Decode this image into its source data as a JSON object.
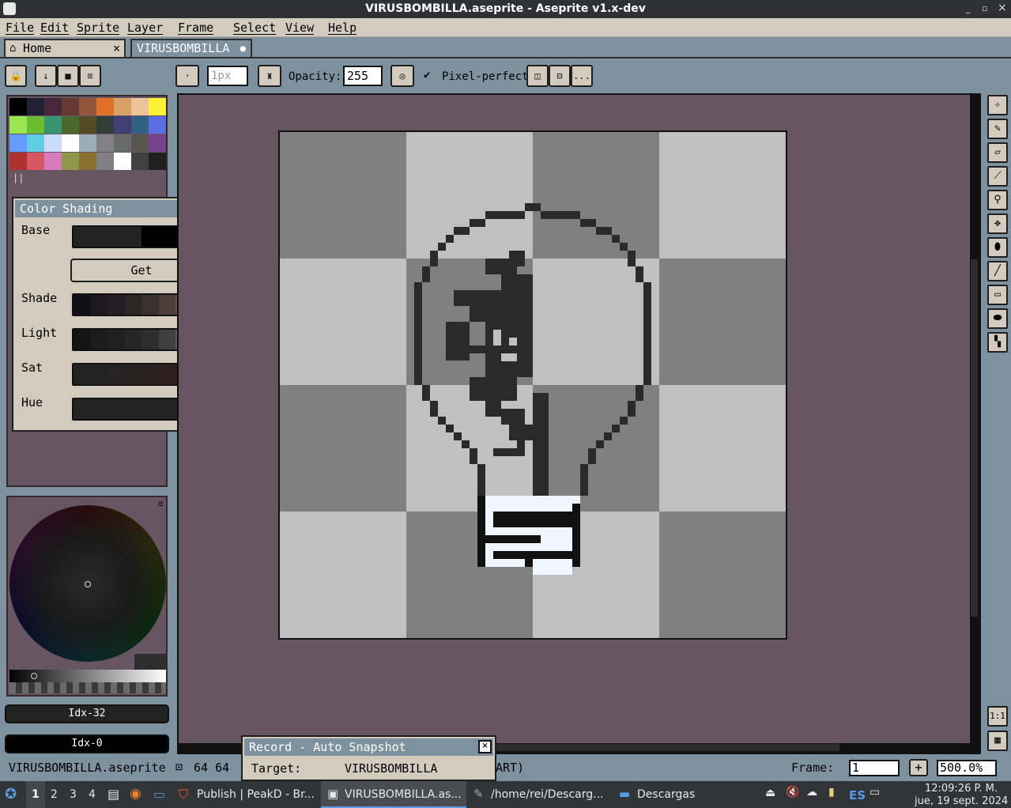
{
  "window": {
    "title": "VIRUSBOMBILLA.aseprite - Aseprite v1.x-dev",
    "min": "_",
    "max": "▫",
    "close": "×"
  },
  "menu": [
    "File",
    "Edit",
    "Sprite",
    "Layer",
    "Frame",
    "Select",
    "View",
    "Help"
  ],
  "tabs": [
    {
      "label": "Home",
      "close": "×"
    },
    {
      "label": "VIRUSBOMBILLA",
      "modified": "●"
    }
  ],
  "toolbar": {
    "brush_size": "1px",
    "opacity_label": "Opacity:",
    "opacity_value": "255",
    "pixel_perfect_label": "Pixel-perfect",
    "more": "..."
  },
  "palette": {
    "colors": [
      "#000000",
      "#222034",
      "#45283c",
      "#663931",
      "#8f563b",
      "#df7126",
      "#d9a066",
      "#eec39a",
      "#fbf236",
      "#99e550",
      "#6abe30",
      "#37946e",
      "#4b692f",
      "#524b24",
      "#323c39",
      "#3f3f74",
      "#306082",
      "#5b6ee1",
      "#639bff",
      "#5fcde4",
      "#cbdbfc",
      "#ffffff",
      "#9badb7",
      "#847e87",
      "#696a6a",
      "#595652",
      "#76428a",
      "#ac3232",
      "#d95763",
      "#d77bba",
      "#8f974a",
      "#8a6f30",
      "#808080",
      "#ffffff",
      "#404040",
      "#202020"
    ]
  },
  "shading": {
    "title": "Color Shading",
    "base_label": "Base",
    "base_colors": [
      "#232323",
      "#000000"
    ],
    "get_label": "Get",
    "shade_label": "Shade",
    "shade_colors": [
      "#0f0f14",
      "#1c1a20",
      "#241f22",
      "#2c2627",
      "#3b312f",
      "#4f3d39",
      "#6b5049",
      "#b98b78"
    ],
    "light_label": "Light",
    "light_colors": [
      "#141414",
      "#1b1b1b",
      "#202020",
      "#262626",
      "#2d2d2d",
      "#404040",
      "#5c5c5c",
      "#8a8a8a"
    ],
    "sat_label": "Sat",
    "sat_colors": [
      "#232323",
      "#232323",
      "#252323",
      "#272222",
      "#2a2121",
      "#2e1f1f",
      "#341c1c",
      "#3c1818"
    ],
    "hue_label": "Hue",
    "hue_colors": [
      "#232323",
      "#232323",
      "#232323",
      "#232323",
      "#232323",
      "#232323",
      "#232323",
      "#232323"
    ]
  },
  "color_indexes": {
    "fg": "Idx-32",
    "bg": "Idx-0"
  },
  "record": {
    "title": "Record - Auto Snapshot",
    "target_label": "Target:",
    "target_value": "VIRUSBOMBILLA"
  },
  "status": {
    "file": "VIRUSBOMBILLA.aseprite",
    "size": "64 64",
    "extra": "ART)",
    "frame_label": "Frame:",
    "frame_value": "1",
    "add": "+",
    "zoom": "500.0%"
  },
  "zoom_actual_label": "1:1",
  "taskbar": {
    "workspaces": [
      "1",
      "2",
      "3",
      "4"
    ],
    "apps": [
      {
        "label": "Publish | PeakD - Br..."
      },
      {
        "label": "VIRUSBOMBILLA.as..."
      },
      {
        "label": "/home/rei/Descarg..."
      },
      {
        "label": "Descargas"
      }
    ],
    "lang": "ES",
    "time": "12:09:26 P. M.",
    "date": "jue, 19 sept. 2024"
  }
}
